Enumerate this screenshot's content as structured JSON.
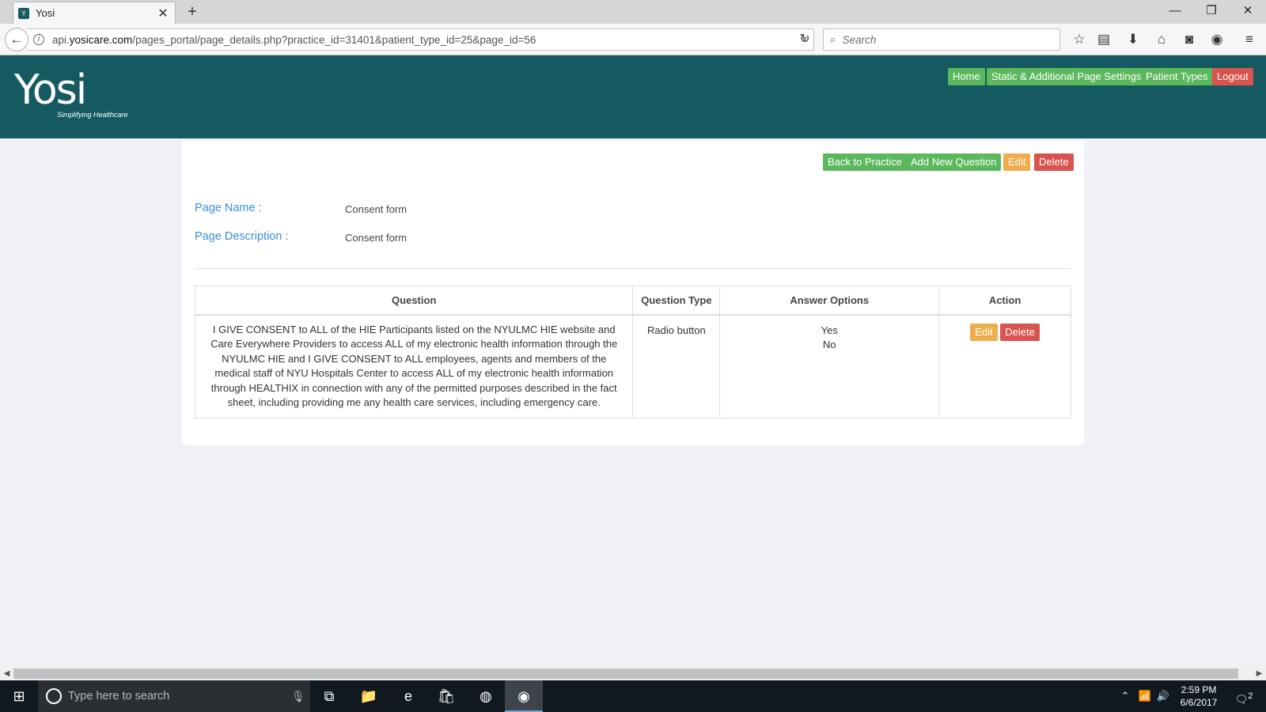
{
  "browser": {
    "tab_title": "Yosi",
    "tab_favicon": "Y",
    "close_glyph": "✕",
    "newtab_glyph": "+",
    "url_prefix": "api.",
    "url_domain": "yosicare.com",
    "url_path": "/pages_portal/page_details.php?practice_id=31401&patient_type_id=25&page_id=56",
    "search_placeholder": "Search",
    "icons": [
      "back-arrow-icon",
      "info-icon",
      "reload-icon",
      "search-icon",
      "bookmark-star-icon",
      "reading-list-icon",
      "download-icon",
      "home-icon",
      "pocket-icon",
      "color-wheel-icon",
      "hamburger-menu-icon"
    ]
  },
  "header": {
    "logo_text": "Yosi",
    "logo_tagline": "Simplifying Healthcare",
    "nav": {
      "home": "Home",
      "static_settings": "Static & Additional Page Settings",
      "patient_types": "Patient Types",
      "logout": "Logout"
    },
    "colors": {
      "header_bg": "#155a60",
      "green": "#5cb85c",
      "red": "#d9534f",
      "orange": "#f0ad4e"
    }
  },
  "page": {
    "actions": {
      "back": "Back to Practice",
      "add_question": "Add New Question",
      "edit": "Edit",
      "delete": "Delete"
    },
    "name_label": "Page Name :",
    "name_value": "Consent form",
    "description_label": "Page Description :",
    "description_value": "Consent form"
  },
  "table": {
    "headers": {
      "question": "Question",
      "question_type": "Question Type",
      "answer_options": "Answer Options",
      "action": "Action"
    },
    "rows": [
      {
        "question": "I GIVE CONSENT to ALL of the HIE Participants listed on the NYULMC HIE website and Care Everywhere Providers to access ALL of my electronic health information through the NYULMC HIE and I GIVE CONSENT to ALL employees, agents and members of the medical staff of NYU Hospitals Center to access ALL of my electronic health information through HEALTHIX in connection with any of the permitted purposes described in the fact sheet, including providing me any health care services, including emergency care.",
        "question_type": "Radio button",
        "answer_options": [
          "Yes",
          "No"
        ],
        "edit": "Edit",
        "delete": "Delete"
      }
    ]
  },
  "taskbar": {
    "search_placeholder": "Type here to search",
    "time": "2:59 PM",
    "date": "6/6/2017",
    "notification_count": "2"
  }
}
